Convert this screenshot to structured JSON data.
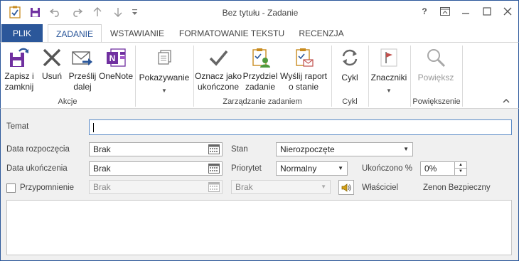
{
  "window": {
    "title": "Bez tytułu - Zadanie",
    "help_label": "?"
  },
  "qat": {
    "icons": [
      "task-app-icon",
      "save-icon",
      "undo-icon",
      "redo-icon",
      "up-icon",
      "down-icon",
      "customize-icon"
    ]
  },
  "tabs": [
    {
      "label": "PLIK"
    },
    {
      "label": "ZADANIE"
    },
    {
      "label": "WSTAWIANIE"
    },
    {
      "label": "FORMATOWANIE TEKSTU"
    },
    {
      "label": "RECENZJA"
    }
  ],
  "ribbon": {
    "groups": {
      "actions": "Akcje",
      "manage": "Zarządzanie zadaniem",
      "cycle": "Cykl",
      "zoom": "Powiększenie"
    },
    "buttons": {
      "save_close_1": "Zapisz i",
      "save_close_2": "zamknij",
      "delete": "Usuń",
      "forward_1": "Prześlij",
      "forward_2": "dalej",
      "onenote": "OneNote",
      "show": "Pokazywanie",
      "mark_complete_1": "Oznacz jako",
      "mark_complete_2": "ukończone",
      "assign_1": "Przydziel",
      "assign_2": "zadanie",
      "send_report_1": "Wyślij raport",
      "send_report_2": "o stanie",
      "recurrence": "Cykl",
      "tags": "Znaczniki",
      "zoom": "Powiększ"
    }
  },
  "form": {
    "subject_label": "Temat",
    "subject_value": "",
    "start_label": "Data rozpoczęcia",
    "start_value": "Brak",
    "due_label": "Data ukończenia",
    "due_value": "Brak",
    "status_label": "Stan",
    "status_value": "Nierozpoczęte",
    "priority_label": "Priorytet",
    "priority_value": "Normalny",
    "complete_label": "Ukończono %",
    "complete_value": "0%",
    "reminder_label": "Przypomnienie",
    "reminder_checked": false,
    "reminder_date": "Brak",
    "reminder_time": "Brak",
    "owner_label": "Właściciel",
    "owner_value": "Zenon Bezpieczny"
  },
  "colors": {
    "accent": "#2b579a",
    "form_bg": "#f0f0f0"
  }
}
